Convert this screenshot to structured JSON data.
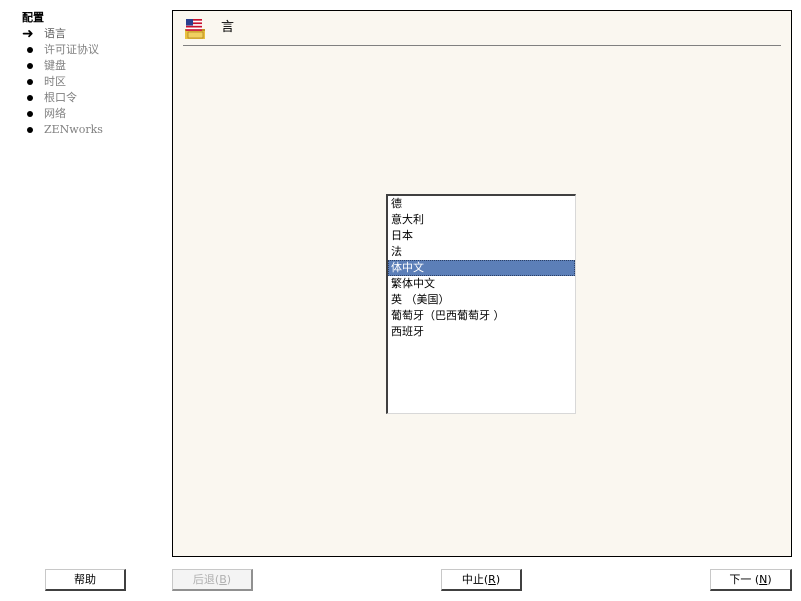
{
  "sidebar": {
    "title": "配置",
    "steps": [
      {
        "label": "语言",
        "current": true
      },
      {
        "label": "许可证协议"
      },
      {
        "label": "键盘"
      },
      {
        "label": "时区"
      },
      {
        "label": "根口令"
      },
      {
        "label": "网络"
      },
      {
        "label": "ZENworks"
      }
    ]
  },
  "panel": {
    "title": "言",
    "icon": "us-flag-icon"
  },
  "language_list": {
    "items": [
      "德",
      "意大利",
      "日本",
      "法",
      "体中文",
      "繁体中文",
      "英 （美国）",
      "葡萄牙（巴西葡萄牙 ）",
      "西班牙"
    ],
    "selected_index": 4
  },
  "buttons": {
    "help": "帮助",
    "back": "后退(",
    "back_mnemonic": "B",
    "back_close": ")",
    "abort": "中止(",
    "abort_mnemonic": "R",
    "abort_close": ")",
    "next": "下一 (",
    "next_mnemonic": "N",
    "next_close": ")"
  },
  "colors": {
    "panel_bg": "#faf7f0",
    "selection": "#5c7fb8"
  }
}
